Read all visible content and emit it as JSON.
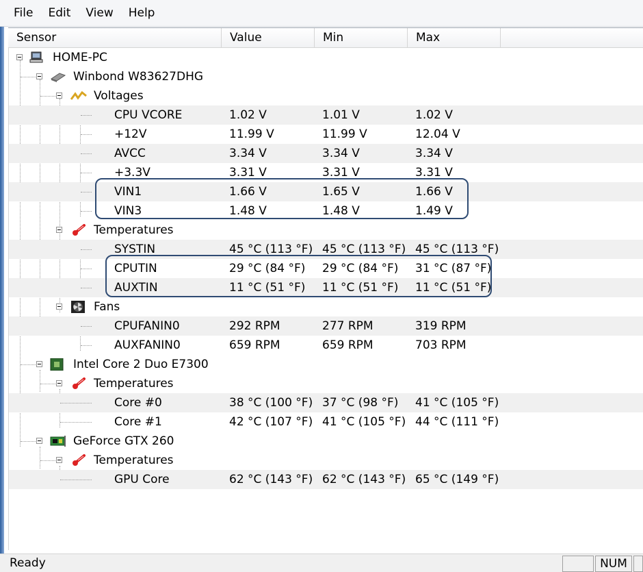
{
  "menu": [
    "File",
    "Edit",
    "View",
    "Help"
  ],
  "columns": [
    "Sensor",
    "Value",
    "Min",
    "Max"
  ],
  "tree": {
    "computer": "HOME-PC",
    "chip1": {
      "name": "Winbond W83627DHG",
      "voltages": {
        "label": "Voltages",
        "rows": [
          {
            "name": "CPU VCORE",
            "value": "1.02 V",
            "min": "1.01 V",
            "max": "1.02 V"
          },
          {
            "name": "+12V",
            "value": "11.99 V",
            "min": "11.99 V",
            "max": "12.04 V"
          },
          {
            "name": "AVCC",
            "value": "3.34 V",
            "min": "3.34 V",
            "max": "3.34 V"
          },
          {
            "name": "+3.3V",
            "value": "3.31 V",
            "min": "3.31 V",
            "max": "3.31 V"
          },
          {
            "name": "VIN1",
            "value": "1.66 V",
            "min": "1.65 V",
            "max": "1.66 V"
          },
          {
            "name": "VIN3",
            "value": "1.48 V",
            "min": "1.48 V",
            "max": "1.49 V"
          }
        ]
      },
      "temperatures": {
        "label": "Temperatures",
        "rows": [
          {
            "name": "SYSTIN",
            "value": "45 °C  (113 °F)",
            "min": "45 °C  (113 °F)",
            "max": "45 °C  (113 °F)"
          },
          {
            "name": "CPUTIN",
            "value": "29 °C  (84 °F)",
            "min": "29 °C  (84 °F)",
            "max": "31 °C  (87 °F)"
          },
          {
            "name": "AUXTIN",
            "value": "11 °C  (51 °F)",
            "min": "11 °C  (51 °F)",
            "max": "11 °C  (51 °F)"
          }
        ]
      },
      "fans": {
        "label": "Fans",
        "rows": [
          {
            "name": "CPUFANIN0",
            "value": "292 RPM",
            "min": "277 RPM",
            "max": "319 RPM"
          },
          {
            "name": "AUXFANIN0",
            "value": "659 RPM",
            "min": "659 RPM",
            "max": "703 RPM"
          }
        ]
      }
    },
    "chip2": {
      "name": "Intel Core 2 Duo E7300",
      "temperatures": {
        "label": "Temperatures",
        "rows": [
          {
            "name": "Core #0",
            "value": "38 °C  (100 °F)",
            "min": "37 °C  (98 °F)",
            "max": "41 °C  (105 °F)"
          },
          {
            "name": "Core #1",
            "value": "42 °C  (107 °F)",
            "min": "41 °C  (105 °F)",
            "max": "44 °C  (111 °F)"
          }
        ]
      }
    },
    "chip3": {
      "name": "GeForce GTX 260",
      "temperatures": {
        "label": "Temperatures",
        "rows": [
          {
            "name": "GPU Core",
            "value": "62 °C  (143 °F)",
            "min": "62 °C  (143 °F)",
            "max": "65 °C  (149 °F)"
          }
        ]
      }
    }
  },
  "status": {
    "text": "Ready",
    "num": "NUM"
  },
  "colors": {
    "highlight": "#2f4b73",
    "alt_row": "#f0f0f0"
  }
}
